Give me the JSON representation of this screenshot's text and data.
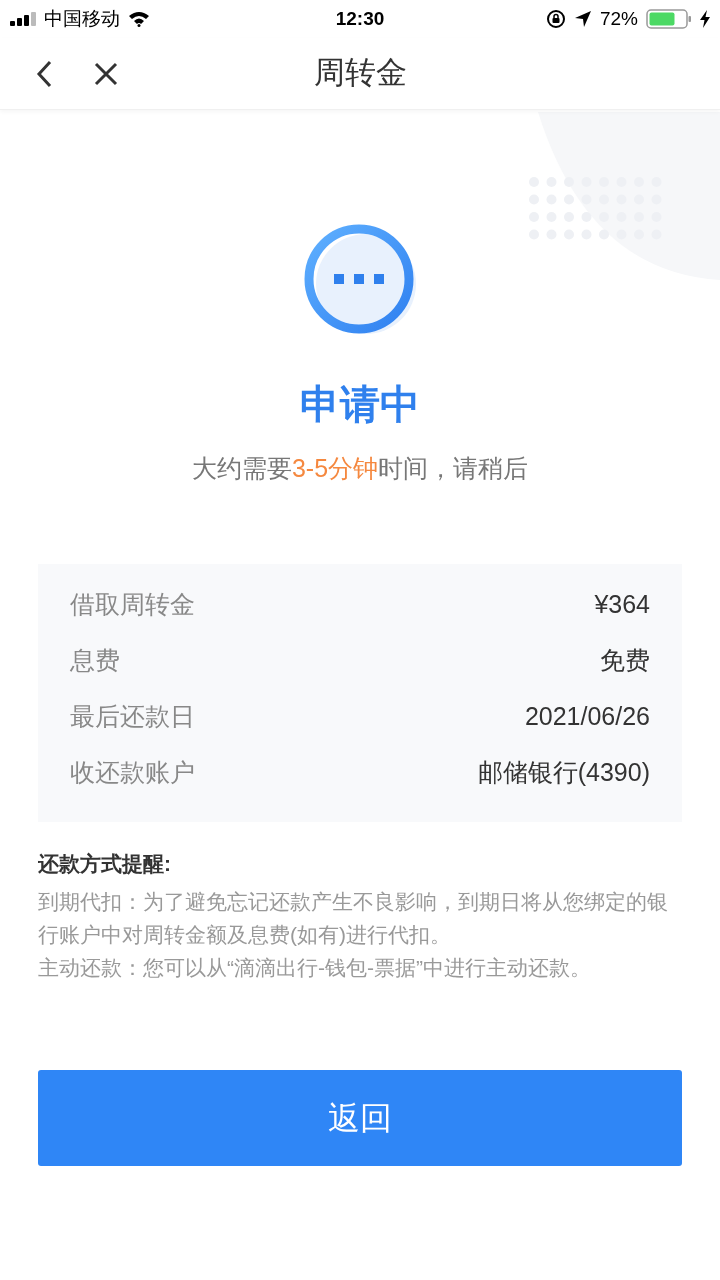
{
  "status_bar": {
    "carrier": "中国移动",
    "time": "12:30",
    "battery": "72%"
  },
  "nav_bar": {
    "title": "周转金"
  },
  "status": {
    "title": "申请中",
    "subtitle": [
      {
        "text": "大约需要",
        "highlighted": false
      },
      {
        "text": "3-5分钟",
        "highlighted": true
      },
      {
        "text": "时间，请稍后",
        "highlighted": false
      }
    ]
  },
  "details": [
    {
      "label": "借取周转金",
      "value": "¥364"
    },
    {
      "label": "息费",
      "value": "免费"
    },
    {
      "label": "最后还款日",
      "value": "2021/06/26"
    },
    {
      "label": "收还款账户",
      "value": "邮储银行(4390)"
    }
  ],
  "reminder": {
    "title": "还款方式提醒:",
    "paragraphs": [
      "到期代扣：为了避免忘记还款产生不良影响，到期日将从您绑定的银行账户中对周转金额及息费(如有)进行代扣。",
      "主动还款：您可以从“滴滴出行-钱包-票据”中进行主动还款。"
    ]
  },
  "buttons": [
    {
      "label": "返回"
    }
  ]
}
